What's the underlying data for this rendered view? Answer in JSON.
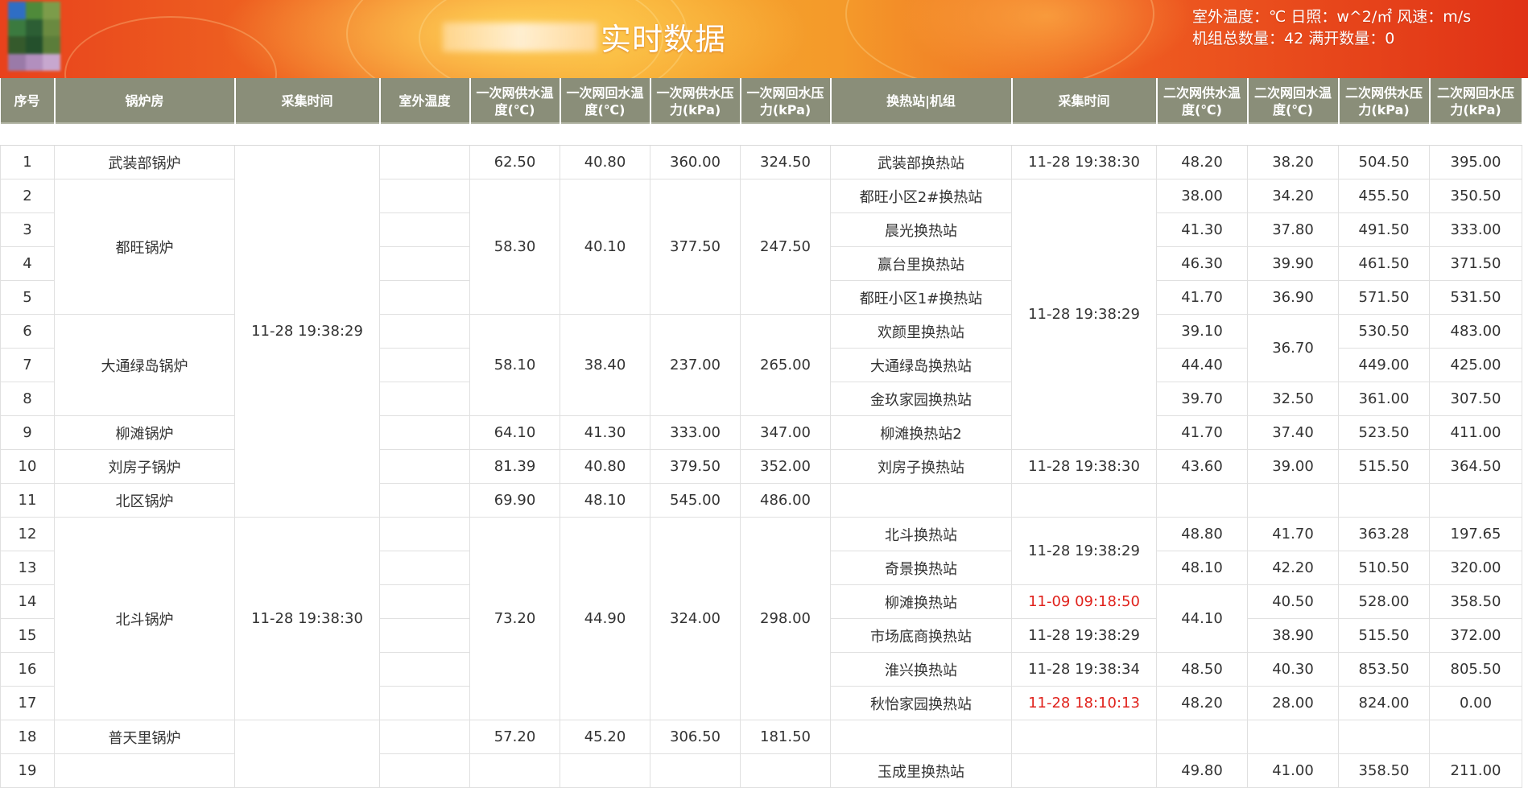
{
  "header": {
    "title": "实时数据",
    "weather": {
      "outdoor_temp_label": "室外温度：℃",
      "sunshine_label": "日照：w^2/㎡",
      "wind_label": "风速：m/s"
    },
    "units_summary": {
      "total_label": "机组总数量：42",
      "full_open_label": "满开数量：0"
    }
  },
  "table": {
    "columns": [
      "序号",
      "锅炉房",
      "采集时间",
      "室外温度",
      "一次网供水温度(℃)",
      "一次网回水温度(℃)",
      "一次网供水压力(kPa)",
      "一次网回水压力(kPa)",
      "换热站|机组",
      "采集时间",
      "二次网供水温度(℃)",
      "二次网回水温度(℃)",
      "二次网供水压力(kPa)",
      "二次网回水压力(kPa)"
    ],
    "rows": [
      {
        "no": "1",
        "boiler": "武装部锅炉",
        "time1": "11-28 19:38:29",
        "t_supply": "62.50",
        "t_return": "40.80",
        "p_supply": "360.00",
        "p_return": "324.50",
        "station": "武装部换热站",
        "time2": "11-28 19:38:30",
        "t2_supply": "48.20",
        "t2_return": "38.20",
        "p2_supply": "504.50",
        "p2_return": "395.00"
      },
      {
        "no": "2",
        "boiler": "都旺锅炉",
        "t_supply": "58.30",
        "t_return": "40.10",
        "p_supply": "377.50",
        "p_return": "247.50",
        "station": "都旺小区2#换热站",
        "time2": "11-28 19:38:29",
        "t2_supply": "38.00",
        "t2_return": "34.20",
        "p2_supply": "455.50",
        "p2_return": "350.50"
      },
      {
        "no": "3",
        "station": "晨光换热站",
        "t2_supply": "41.30",
        "t2_return": "37.80",
        "p2_supply": "491.50",
        "p2_return": "333.00"
      },
      {
        "no": "4",
        "station": "赢台里换热站",
        "t2_supply": "46.30",
        "t2_return": "39.90",
        "p2_supply": "461.50",
        "p2_return": "371.50"
      },
      {
        "no": "5",
        "station": "都旺小区1#换热站",
        "t2_supply": "41.70",
        "t2_return": "36.90",
        "p2_supply": "571.50",
        "p2_return": "531.50"
      },
      {
        "no": "6",
        "boiler": "大通绿岛锅炉",
        "t_supply": "58.10",
        "t_return": "38.40",
        "p_supply": "237.00",
        "p_return": "265.00",
        "station": "欢颜里换热站",
        "t2_supply": "39.10",
        "t2_return": "36.70",
        "p2_supply": "530.50",
        "p2_return": "483.00"
      },
      {
        "no": "7",
        "station": "大通绿岛换热站",
        "t2_supply": "44.40",
        "p2_supply": "449.00",
        "p2_return": "425.00"
      },
      {
        "no": "8",
        "station": "金玖家园换热站",
        "t2_supply": "39.70",
        "t2_return": "32.50",
        "p2_supply": "361.00",
        "p2_return": "307.50"
      },
      {
        "no": "9",
        "boiler": "柳滩锅炉",
        "t_supply": "64.10",
        "t_return": "41.30",
        "p_supply": "333.00",
        "p_return": "347.00",
        "station": "柳滩换热站2",
        "t2_supply": "41.70",
        "t2_return": "37.40",
        "p2_supply": "523.50",
        "p2_return": "411.00"
      },
      {
        "no": "10",
        "boiler": "刘房子锅炉",
        "t_supply": "81.39",
        "t_return": "40.80",
        "p_supply": "379.50",
        "p_return": "352.00",
        "station": "刘房子换热站",
        "time2": "11-28 19:38:30",
        "t2_supply": "43.60",
        "t2_return": "39.00",
        "p2_supply": "515.50",
        "p2_return": "364.50"
      },
      {
        "no": "11",
        "boiler": "北区锅炉",
        "t_supply": "69.90",
        "t_return": "48.10",
        "p_supply": "545.00",
        "p_return": "486.00"
      },
      {
        "no": "12",
        "boiler": "北斗锅炉",
        "time1": "11-28 19:38:30",
        "t_supply": "73.20",
        "t_return": "44.90",
        "p_supply": "324.00",
        "p_return": "298.00",
        "station": "北斗换热站",
        "time2": "11-28 19:38:29",
        "t2_supply": "48.80",
        "t2_return": "41.70",
        "p2_supply": "363.28",
        "p2_return": "197.65"
      },
      {
        "no": "13",
        "station": "奇景换热站",
        "t2_supply": "48.10",
        "t2_return": "42.20",
        "p2_supply": "510.50",
        "p2_return": "320.00"
      },
      {
        "no": "14",
        "station": "柳滩换热站",
        "time2": "11-09 09:18:50",
        "t2_supply": "44.10",
        "t2_return": "40.50",
        "p2_supply": "528.00",
        "p2_return": "358.50"
      },
      {
        "no": "15",
        "station": "市场底商换热站",
        "time2": "11-28 19:38:29",
        "t2_return": "38.90",
        "p2_supply": "515.50",
        "p2_return": "372.00"
      },
      {
        "no": "16",
        "station": "淮兴换热站",
        "time2": "11-28 19:38:34",
        "t2_supply": "48.50",
        "t2_return": "40.30",
        "p2_supply": "853.50",
        "p2_return": "805.50"
      },
      {
        "no": "17",
        "station": "秋怡家园换热站",
        "time2": "11-28 18:10:13",
        "t2_supply": "48.20",
        "t2_return": "28.00",
        "p2_supply": "824.00",
        "p2_return": "0.00"
      },
      {
        "no": "18",
        "boiler": "普天里锅炉",
        "t_supply": "57.20",
        "t_return": "45.20",
        "p_supply": "306.50",
        "p_return": "181.50"
      },
      {
        "no": "19",
        "station": "玉成里换热站",
        "t2_supply": "49.80",
        "t2_return": "41.00",
        "p2_supply": "358.50",
        "p2_return": "211.00"
      }
    ]
  },
  "colors": {
    "header_bg": "#f05a22",
    "table_header_bg": "#8a8e79",
    "stale_time_text": "#e0221c"
  }
}
